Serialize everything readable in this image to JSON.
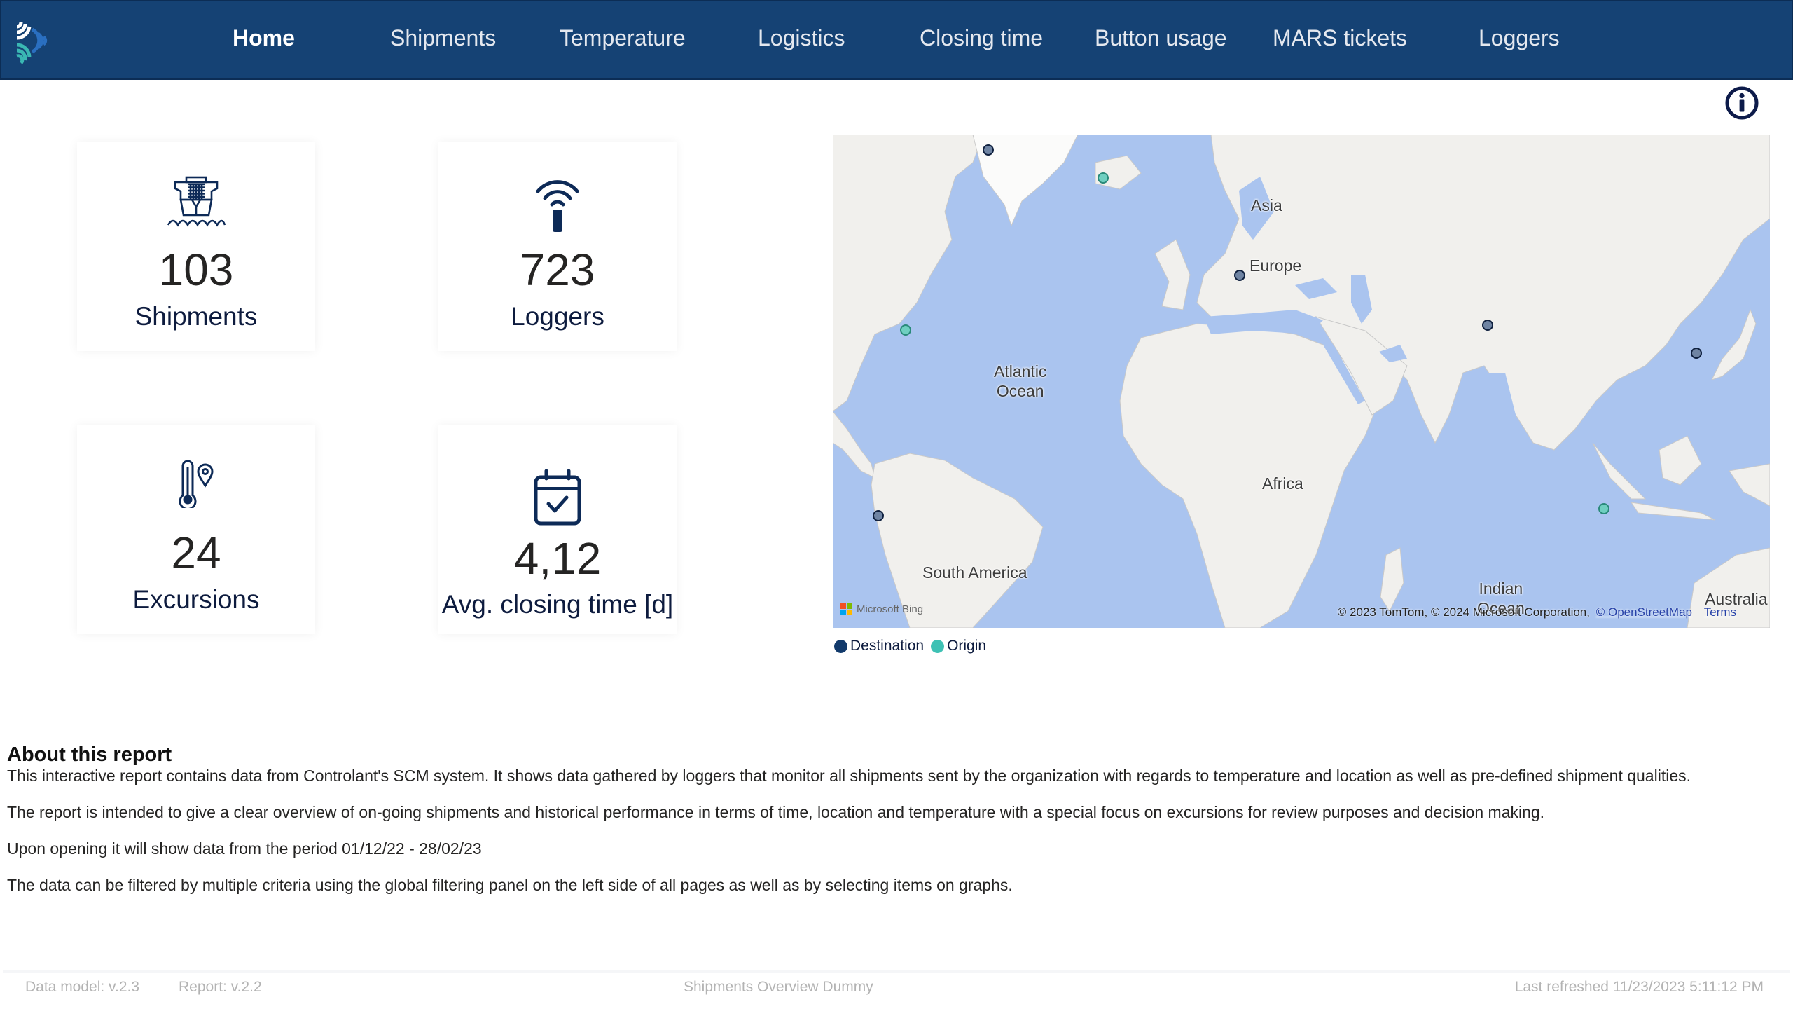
{
  "nav": {
    "items": [
      {
        "label": "Home",
        "active": true
      },
      {
        "label": "Shipments",
        "active": false
      },
      {
        "label": "Temperature",
        "active": false
      },
      {
        "label": "Logistics",
        "active": false
      },
      {
        "label": "Closing time",
        "active": false
      },
      {
        "label": "Button usage",
        "active": false
      },
      {
        "label": "MARS tickets",
        "active": false
      },
      {
        "label": "Loggers",
        "active": false
      }
    ]
  },
  "info_icon": "info-icon",
  "kpis": {
    "shipments": {
      "value": "103",
      "label": "Shipments",
      "icon": "ship-icon"
    },
    "loggers": {
      "value": "723",
      "label": "Loggers",
      "icon": "signal-logger-icon"
    },
    "excursions": {
      "value": "24",
      "label": "Excursions",
      "icon": "thermometer-pin-icon"
    },
    "closing_time": {
      "value": "4,12",
      "label": "Avg. closing time [d]",
      "icon": "calendar-check-icon"
    }
  },
  "map": {
    "labels": {
      "europe": "Europe",
      "asia": "Asia",
      "atlantic": "Atlantic\nOcean",
      "africa": "Africa",
      "south_america": "South America",
      "indian": "Indian\nOcean",
      "australia": "Australia"
    },
    "markers": [
      {
        "type": "Destination",
        "place": "Greenland"
      },
      {
        "type": "Origin",
        "place": "Iceland"
      },
      {
        "type": "Destination",
        "place": "Central Europe"
      },
      {
        "type": "Origin",
        "place": "US East Coast"
      },
      {
        "type": "Destination",
        "place": "Central Asia"
      },
      {
        "type": "Destination",
        "place": "South Korea"
      },
      {
        "type": "Destination",
        "place": "Ecuador"
      },
      {
        "type": "Origin",
        "place": "Sumatra"
      }
    ],
    "provider": "Microsoft Bing",
    "attribution": "© 2023 TomTom, © 2024 Microsoft Corporation,",
    "osm_link": "© OpenStreetMap",
    "terms_link": "Terms"
  },
  "legend": {
    "destination": {
      "label": "Destination",
      "color": "#123a6b"
    },
    "origin": {
      "label": "Origin",
      "color": "#3ec1b4"
    }
  },
  "about": {
    "title": "About this report",
    "paragraphs": [
      "This interactive report contains data from Controlant's SCM system. It shows data gathered by loggers that monitor all shipments sent by the organization with regards to temperature and location as well as pre-defined shipment qualities.",
      "The report is intended to give a clear overview of on-going shipments and historical performance in terms of time, location and temperature with a special focus on excursions for review purposes and decision making.",
      "Upon opening it will show data from the period 01/12/22 - 28/02/23",
      "The data can be filtered by multiple criteria using the global filtering panel on the left side of all pages as well as by selecting items on graphs."
    ]
  },
  "footer": {
    "data_model": "Data model: v.2.3",
    "report": "Report: v.2.2",
    "title": "Shipments Overview Dummy",
    "refreshed": "Last refreshed 11/23/2023 5:11:12 PM"
  },
  "colors": {
    "nav_bg": "#154274",
    "icon_navy": "#0d2a57",
    "ocean": "#aac4ef",
    "land": "#f1f0ed"
  }
}
